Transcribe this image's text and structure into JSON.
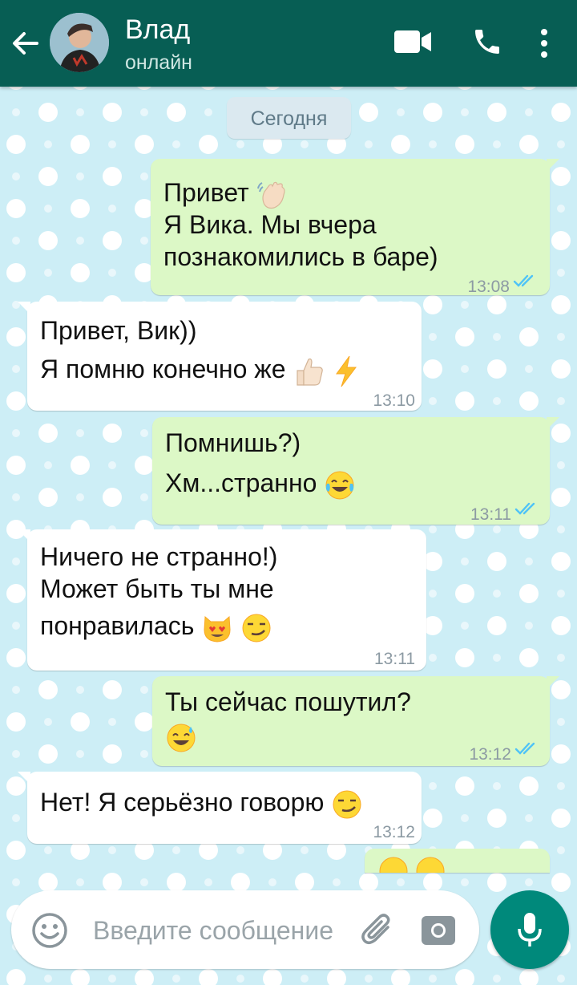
{
  "header": {
    "contact_name": "Влад",
    "status": "онлайн",
    "icons": [
      "back-arrow-icon",
      "video-call-icon",
      "phone-icon",
      "more-vert-icon"
    ]
  },
  "date_separator": "Сегодня",
  "messages": [
    {
      "direction": "outgoing",
      "lines": [
        "Привет",
        "Я Вика. Мы вчера",
        "познакомились в баре)"
      ],
      "time": "13:08",
      "read": true
    },
    {
      "direction": "incoming",
      "lines": [
        "Привет, Вик))",
        "Я помню конечно же"
      ],
      "time": "13:10"
    },
    {
      "direction": "outgoing",
      "lines": [
        "Помнишь?)",
        "Хм...странно"
      ],
      "time": "13:11",
      "read": true
    },
    {
      "direction": "incoming",
      "lines": [
        "Ничего не странно!)",
        "Может быть ты мне",
        "понравилась"
      ],
      "time": "13:11"
    },
    {
      "direction": "outgoing",
      "lines": [
        "Ты сейчас пошутил?"
      ],
      "time": "13:12",
      "read": true
    },
    {
      "direction": "incoming",
      "lines": [
        "Нет! Я серьёзно говорю"
      ],
      "time": "13:12"
    }
  ],
  "composer": {
    "placeholder": "Введите сообщение",
    "icons": [
      "emoji-icon",
      "attach-icon",
      "camera-icon",
      "mic-icon"
    ]
  },
  "colors": {
    "header": "#075e54",
    "outgoing_bubble": "#dcf8c6",
    "incoming_bubble": "#ffffff",
    "read_ticks": "#4fc3f7",
    "mic_button": "#00897b",
    "wallpaper": "#cdeef6"
  }
}
